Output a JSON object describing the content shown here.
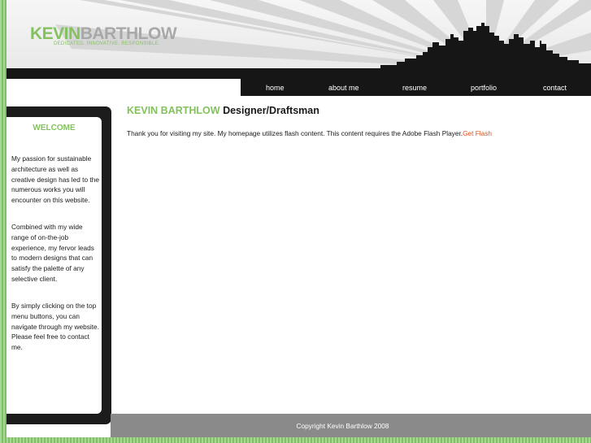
{
  "header": {
    "logo_first": "KEVIN",
    "logo_last": "BARTHLOW",
    "tagline": "DEDICATED. INNOVATIVE. RESPONSIBLE."
  },
  "nav": {
    "items": [
      "home",
      "about me",
      "resume",
      "portfolio",
      "contact"
    ]
  },
  "sidebar": {
    "heading": "WELCOME",
    "paragraphs": [
      "My passion for sustainable architecture as well as creative design has led to the numerous works you will encounter on this website.",
      "Combined with my wide range of on-the-job experience, my fervor leads to modern designs that can satisfy the palette of any selective client.",
      "By simply clicking on the top menu buttons, you can navigate through my website. Please feel free to contact me."
    ]
  },
  "main": {
    "title_name": "KEVIN BARTHLOW",
    "title_role": "Designer/Draftsman",
    "text": "Thank you for visiting my site. My homepage utilizes flash content. This content requires the Adobe Flash Player.",
    "link": "Get Flash"
  },
  "footer": {
    "copyright": "Copyright Kevin Barthlow 2008"
  },
  "colors": {
    "accent_green": "#84c25f",
    "link_orange": "#e0531f",
    "dark": "#161616",
    "footer_gray": "#8a8a8a"
  }
}
